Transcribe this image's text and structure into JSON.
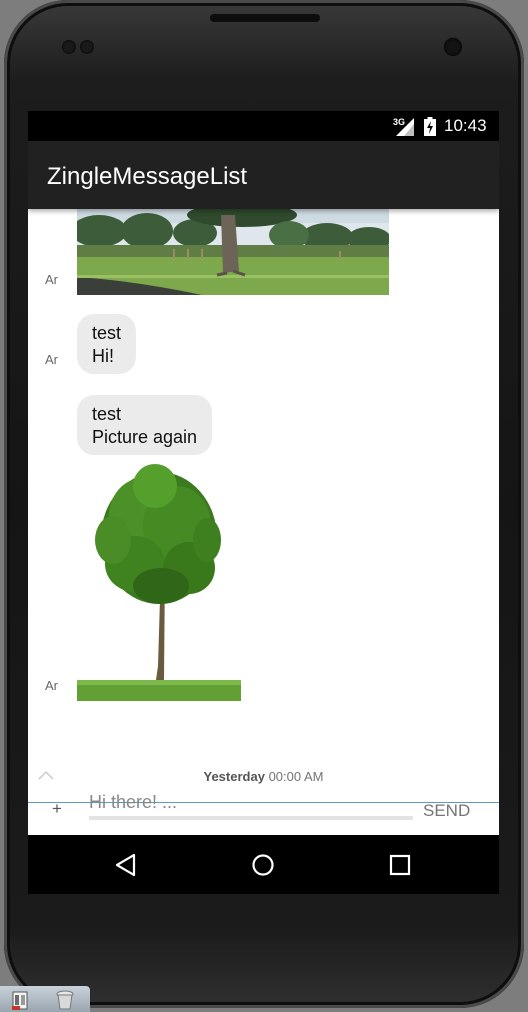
{
  "status_bar": {
    "network": "3G",
    "time": "10:43",
    "icons": [
      "signal-icon",
      "battery-charging-icon"
    ]
  },
  "app_bar": {
    "title": "ZingleMessageList"
  },
  "messages": [
    {
      "type": "image",
      "avatar_label": "Ar",
      "icon": "park-photo"
    },
    {
      "type": "text",
      "avatar_label": "Ar",
      "lines": [
        "test",
        "Hi!"
      ]
    },
    {
      "type": "text",
      "avatar_label": "",
      "lines": [
        "test",
        "Picture again"
      ]
    },
    {
      "type": "image",
      "avatar_label": "Ar",
      "icon": "tree-photo"
    }
  ],
  "date_divider": {
    "day": "Yesterday",
    "time": "00:00 AM",
    "icon": "chevron-up-icon"
  },
  "composer": {
    "attach_label": "+",
    "placeholder": "Hi there! ...",
    "value": "",
    "send_label": "SEND"
  },
  "nav_bar": {
    "icons": [
      "back-icon",
      "home-icon",
      "recents-icon"
    ]
  },
  "colors": {
    "app_bar": "#212121",
    "status_bar": "#000000",
    "bubble": "#ebebeb",
    "divider_accent": "#5c9db5"
  }
}
